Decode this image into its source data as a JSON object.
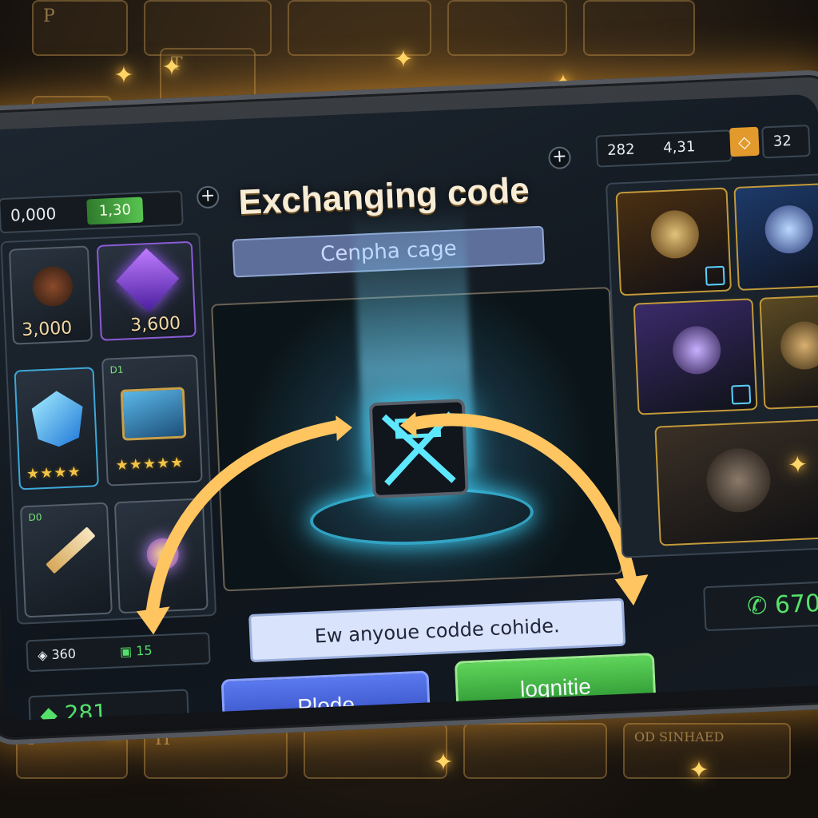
{
  "background_keys": [
    "P",
    "T",
    "H",
    "P"
  ],
  "header": {
    "title": "Exchanging code",
    "subtitle_field": "Cenpha cage"
  },
  "top_left": {
    "currency_value": "0,000",
    "badge_value": "1,30"
  },
  "top_right": {
    "left_value": "282",
    "mid_value": "4,31",
    "right_value": "32"
  },
  "left_grid": {
    "tiles": [
      {
        "label": "3,000"
      },
      {
        "label": "3,600"
      },
      {
        "stars": "★★★★"
      },
      {
        "tag": "D1",
        "stars": "★★★★★"
      },
      {
        "tag": "D0"
      },
      {
        "tag": ""
      }
    ]
  },
  "center": {
    "code_input_placeholder": "Ew anyoue codde cohide."
  },
  "buttons": {
    "left": "Plode",
    "right": "lognitie"
  },
  "bottom_left": {
    "small_left": "360",
    "small_right": "15",
    "main_value": "281"
  },
  "bottom_right": {
    "value": "670"
  },
  "reflection_text": "OD SINHAED",
  "colors": {
    "accent_blue": "#3ed7ff",
    "accent_gold": "#ffcf57",
    "green_button": "#34b33d",
    "blue_button": "#3b5bd8"
  }
}
